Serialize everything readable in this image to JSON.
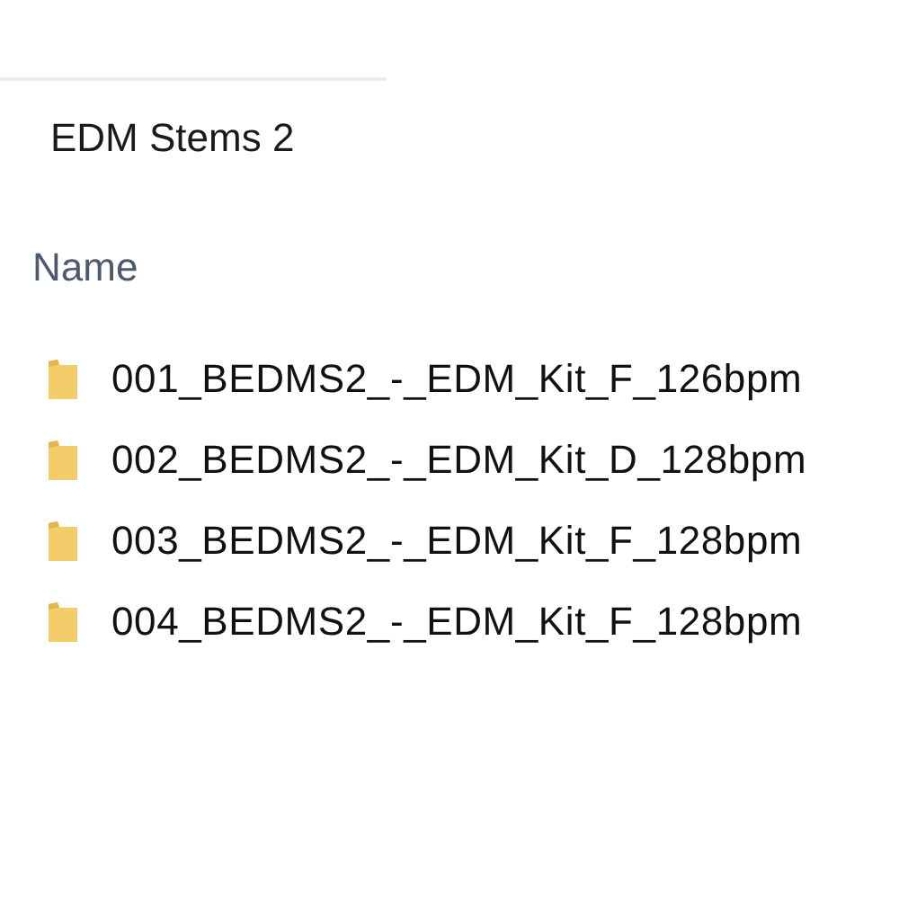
{
  "folder_title": "EDM Stems 2",
  "column_header": "Name",
  "items": [
    {
      "name": "001_BEDMS2_-_EDM_Kit_F_126bpm",
      "kind": "folder"
    },
    {
      "name": "002_BEDMS2_-_EDM_Kit_D_128bpm",
      "kind": "folder"
    },
    {
      "name": "003_BEDMS2_-_EDM_Kit_F_128bpm",
      "kind": "folder"
    },
    {
      "name": "004_BEDMS2_-_EDM_Kit_F_128bpm",
      "kind": "folder"
    }
  ]
}
